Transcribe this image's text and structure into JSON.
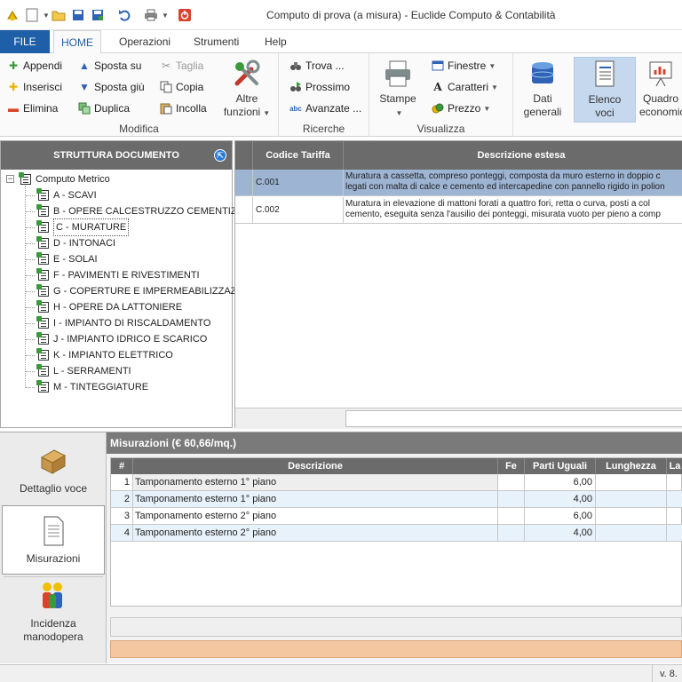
{
  "window": {
    "title": "Computo di prova (a misura) - Euclide Computo & Contabilità",
    "quick_access": [
      "save-icon",
      "new-document-icon",
      "open-folder-icon",
      "save-disk-icon",
      "save-all-icon",
      "undo-icon",
      "print-icon",
      "power-icon"
    ]
  },
  "ribbon_tabs": {
    "file": "FILE",
    "home": "HOME",
    "operazioni": "Operazioni",
    "strumenti": "Strumenti",
    "help": "Help"
  },
  "ribbon": {
    "modifica": {
      "label": "Modifica",
      "appendi": "Appendi",
      "inserisci": "Inserisci",
      "elimina": "Elimina",
      "sposta_su": "Sposta su",
      "sposta_giu": "Sposta giù",
      "duplica": "Duplica",
      "taglia": "Taglia",
      "copia": "Copia",
      "incolla": "Incolla",
      "altre_funzioni_1": "Altre",
      "altre_funzioni_2": "funzioni"
    },
    "ricerche": {
      "label": "Ricerche",
      "trova": "Trova ...",
      "prossimo": "Prossimo",
      "avanzate": "Avanzate ..."
    },
    "visualizza": {
      "label": "Visualizza",
      "stampe": "Stampe",
      "finestre": "Finestre",
      "caratteri": "Caratteri",
      "prezzo": "Prezzo"
    },
    "dati_generali_1": "Dati",
    "dati_generali_2": "generali",
    "elenco_voci_1": "Elenco",
    "elenco_voci_2": "voci",
    "quadro_1": "Quadro",
    "quadro_2": "economic"
  },
  "struttura": {
    "header": "STRUTTURA DOCUMENTO",
    "root": "Computo Metrico",
    "items": [
      "A - SCAVI",
      "B - OPERE CALCESTRUZZO CEMENTIZIO",
      "C - MURATURE",
      "D - INTONACI",
      "E - SOLAI",
      "F - PAVIMENTI E RIVESTIMENTI",
      "G - COPERTURE E IMPERMEABILIZZAZIONI",
      "H - OPERE DA LATTONIERE",
      "I - IMPIANTO DI RISCALDAMENTO",
      "J - IMPIANTO IDRICO E SCARICO",
      "K - IMPIANTO ELETTRICO",
      "L - SERRAMENTI",
      "M - TINTEGGIATURE"
    ]
  },
  "voci_grid": {
    "headers": {
      "codice": "Codice Tariffa",
      "descrizione": "Descrizione estesa"
    },
    "rows": [
      {
        "codice": "C.001",
        "line1": "Muratura a cassetta, compreso ponteggi, composta da muro esterno in doppio c",
        "line2": "legati con malta di calce e cemento ed intercapedine con pannello rigido in polion"
      },
      {
        "codice": "C.002",
        "line1": "Muratura in elevazione di mattoni forati a quattro fori, retta o curva, posti a col",
        "line2": "cemento, eseguita senza l'ausilio dei ponteggi, misurata vuoto per pieno a comp"
      }
    ]
  },
  "sidenav": {
    "dettaglio": "Dettaglio voce",
    "misurazioni": "Misurazioni",
    "incidenza_1": "Incidenza",
    "incidenza_2": "manodopera"
  },
  "misurazioni": {
    "title": "Misurazioni (€ 60,66/mq.)",
    "headers": {
      "num": "#",
      "descrizione": "Descrizione",
      "fe": "Fe",
      "parti": "Parti Uguali",
      "lunghezza": "Lunghezza",
      "larghezza": "La"
    },
    "rows": [
      {
        "num": "1",
        "descrizione": "Tamponamento esterno 1° piano",
        "parti": "6,00"
      },
      {
        "num": "2",
        "descrizione": "Tamponamento esterno 1° piano",
        "parti": "4,00"
      },
      {
        "num": "3",
        "descrizione": "Tamponamento esterno 2° piano",
        "parti": "6,00"
      },
      {
        "num": "4",
        "descrizione": "Tamponamento esterno 2° piano",
        "parti": "4,00"
      }
    ]
  },
  "status": {
    "version": "v. 8."
  },
  "colors": {
    "file_tab": "#1f5fa8",
    "header_gray": "#6b6b6b",
    "selected_row": "#9db4d3",
    "alt_row": "#e8f2fb",
    "total_bar": "#f5c7a0"
  }
}
